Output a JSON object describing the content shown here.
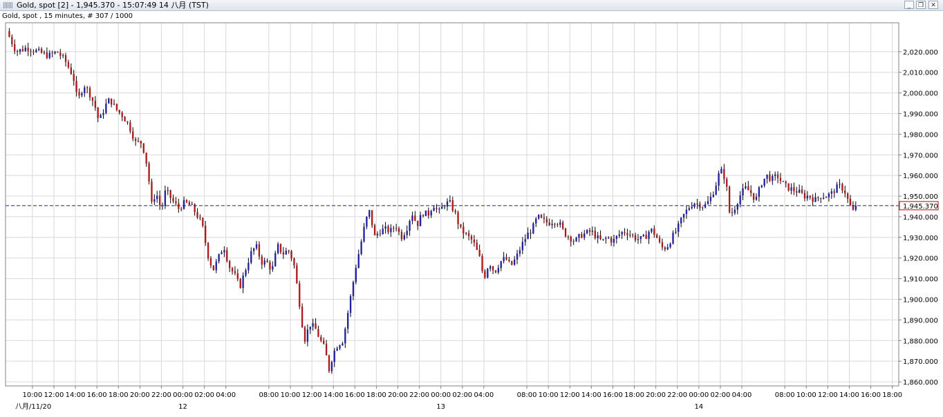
{
  "window": {
    "title": "Gold, spot [2] - 1,945.370 - 15:07:49  14 八月 (TST)",
    "icon": "chart-window-icon",
    "controls": {
      "minimize": "_",
      "maximize": "❐",
      "close": "✕"
    }
  },
  "chart_header": "Gold, spot , 15 minutes, # 307 / 1000",
  "colors": {
    "up_candle": "#2020a0",
    "down_candle": "#b01818",
    "grid": "#d8d8d8",
    "current_line": "#1c1c8c",
    "current_label": "#c00000"
  },
  "chart_data": {
    "type": "candlestick",
    "instrument": "Gold, spot",
    "interval": "15 minutes",
    "bars_shown": "307 / 1000",
    "current_price": 1945.37,
    "current_price_label": "1,945.370",
    "ylim": [
      1858,
      2034
    ],
    "y_ticks": [
      "2,020.000",
      "2,010.000",
      "2,000.000",
      "1,990.000",
      "1,980.000",
      "1,970.000",
      "1,960.000",
      "1,950.000",
      "1,940.000",
      "1,930.000",
      "1,920.000",
      "1,910.000",
      "1,900.000",
      "1,890.000",
      "1,880.000",
      "1,870.000",
      "1,860.000"
    ],
    "y_tick_values": [
      2020,
      2010,
      2000,
      1990,
      1980,
      1970,
      1960,
      1950,
      1940,
      1930,
      1920,
      1910,
      1900,
      1890,
      1880,
      1870,
      1860
    ],
    "x_range_hours": [
      7.5,
      90.6
    ],
    "x_ticks": [
      {
        "h": 10,
        "label": "10:00"
      },
      {
        "h": 12,
        "label": "12:00"
      },
      {
        "h": 14,
        "label": "14:00"
      },
      {
        "h": 16,
        "label": "16:00"
      },
      {
        "h": 18,
        "label": "18:00"
      },
      {
        "h": 20,
        "label": "20:00"
      },
      {
        "h": 22,
        "label": "22:00"
      },
      {
        "h": 24,
        "label": "00:00"
      },
      {
        "h": 26,
        "label": "02:00"
      },
      {
        "h": 28,
        "label": "04:00"
      },
      {
        "h": 32,
        "label": "08:00"
      },
      {
        "h": 34,
        "label": "10:00"
      },
      {
        "h": 36,
        "label": "12:00"
      },
      {
        "h": 38,
        "label": "14:00"
      },
      {
        "h": 40,
        "label": "16:00"
      },
      {
        "h": 42,
        "label": "18:00"
      },
      {
        "h": 44,
        "label": "20:00"
      },
      {
        "h": 46,
        "label": "22:00"
      },
      {
        "h": 48,
        "label": "00:00"
      },
      {
        "h": 50,
        "label": "02:00"
      },
      {
        "h": 52,
        "label": "04:00"
      },
      {
        "h": 56,
        "label": "08:00"
      },
      {
        "h": 58,
        "label": "10:00"
      },
      {
        "h": 60,
        "label": "12:00"
      },
      {
        "h": 62,
        "label": "14:00"
      },
      {
        "h": 64,
        "label": "16:00"
      },
      {
        "h": 66,
        "label": "18:00"
      },
      {
        "h": 68,
        "label": "20:00"
      },
      {
        "h": 70,
        "label": "22:00"
      },
      {
        "h": 72,
        "label": "00:00"
      },
      {
        "h": 74,
        "label": "02:00"
      },
      {
        "h": 76,
        "label": "04:00"
      },
      {
        "h": 80,
        "label": "08:00"
      },
      {
        "h": 82,
        "label": "10:00"
      },
      {
        "h": 84,
        "label": "12:00"
      },
      {
        "h": 86,
        "label": "14:00"
      },
      {
        "h": 88,
        "label": "16:00"
      },
      {
        "h": 90,
        "label": "18:00"
      }
    ],
    "date_labels": [
      {
        "h": 9,
        "label": "八月/11/20"
      },
      {
        "h": 24,
        "label": "12"
      },
      {
        "h": 48,
        "label": "13"
      },
      {
        "h": 72,
        "label": "14"
      }
    ],
    "price_path": [
      [
        7.6,
        2030
      ],
      [
        8.5,
        2020
      ],
      [
        9.5,
        2022
      ],
      [
        10.5,
        2020
      ],
      [
        11.5,
        2018
      ],
      [
        12.3,
        2020
      ],
      [
        13,
        2016
      ],
      [
        13.8,
        2008
      ],
      [
        14.2,
        1996
      ],
      [
        14.8,
        2004
      ],
      [
        15.3,
        2000
      ],
      [
        15.8,
        1994
      ],
      [
        16.2,
        1986
      ],
      [
        16.8,
        1994
      ],
      [
        17.2,
        1997
      ],
      [
        17.8,
        1992
      ],
      [
        18.4,
        1989
      ],
      [
        19,
        1984
      ],
      [
        19.6,
        1976
      ],
      [
        20.2,
        1976
      ],
      [
        20.7,
        1964
      ],
      [
        21.1,
        1946
      ],
      [
        21.5,
        1952
      ],
      [
        22,
        1943
      ],
      [
        22.4,
        1953
      ],
      [
        23,
        1948
      ],
      [
        23.6,
        1944
      ],
      [
        24.2,
        1947
      ],
      [
        24.8,
        1945
      ],
      [
        25.3,
        1941
      ],
      [
        25.8,
        1936
      ],
      [
        26.3,
        1922
      ],
      [
        26.8,
        1914
      ],
      [
        27.3,
        1920
      ],
      [
        27.8,
        1926
      ],
      [
        28.3,
        1916
      ],
      [
        28.8,
        1912
      ],
      [
        29.3,
        1906
      ],
      [
        29.8,
        1914
      ],
      [
        30.3,
        1922
      ],
      [
        30.8,
        1926
      ],
      [
        31.3,
        1918
      ],
      [
        31.8,
        1918
      ],
      [
        32.3,
        1914
      ],
      [
        32.8,
        1926
      ],
      [
        33.3,
        1922
      ],
      [
        33.8,
        1924
      ],
      [
        34.3,
        1918
      ],
      [
        34.8,
        1900
      ],
      [
        35.3,
        1880
      ],
      [
        35.8,
        1888
      ],
      [
        36.3,
        1886
      ],
      [
        36.8,
        1880
      ],
      [
        37.2,
        1876
      ],
      [
        37.6,
        1866
      ],
      [
        38,
        1874
      ],
      [
        38.4,
        1878
      ],
      [
        38.9,
        1880
      ],
      [
        39.3,
        1892
      ],
      [
        39.7,
        1904
      ],
      [
        40.1,
        1916
      ],
      [
        40.6,
        1928
      ],
      [
        41,
        1938
      ],
      [
        41.4,
        1943
      ],
      [
        41.8,
        1930
      ],
      [
        42.3,
        1933
      ],
      [
        42.8,
        1934
      ],
      [
        43.3,
        1933
      ],
      [
        43.8,
        1936
      ],
      [
        44.3,
        1930
      ],
      [
        44.8,
        1934
      ],
      [
        45.3,
        1942
      ],
      [
        45.8,
        1936
      ],
      [
        46.3,
        1942
      ],
      [
        46.8,
        1941
      ],
      [
        47.3,
        1946
      ],
      [
        47.8,
        1942
      ],
      [
        48.3,
        1946
      ],
      [
        48.8,
        1947
      ],
      [
        49.3,
        1942
      ],
      [
        49.8,
        1934
      ],
      [
        50.4,
        1931
      ],
      [
        51,
        1928
      ],
      [
        51.6,
        1920
      ],
      [
        52,
        1910
      ],
      [
        52.5,
        1918
      ],
      [
        53,
        1913
      ],
      [
        53.5,
        1918
      ],
      [
        54,
        1920
      ],
      [
        54.5,
        1916
      ],
      [
        55,
        1920
      ],
      [
        55.5,
        1926
      ],
      [
        56,
        1931
      ],
      [
        56.5,
        1934
      ],
      [
        57,
        1940
      ],
      [
        57.5,
        1938
      ],
      [
        58,
        1937
      ],
      [
        58.5,
        1938
      ],
      [
        59,
        1937
      ],
      [
        59.5,
        1932
      ],
      [
        60,
        1930
      ],
      [
        60.5,
        1928
      ],
      [
        61,
        1931
      ],
      [
        61.5,
        1932
      ],
      [
        62,
        1933
      ],
      [
        62.5,
        1930
      ],
      [
        63,
        1928
      ],
      [
        63.5,
        1930
      ],
      [
        64,
        1928
      ],
      [
        64.5,
        1931
      ],
      [
        65,
        1933
      ],
      [
        65.5,
        1932
      ],
      [
        66,
        1930
      ],
      [
        66.5,
        1929
      ],
      [
        67,
        1930
      ],
      [
        67.5,
        1934
      ],
      [
        68,
        1931
      ],
      [
        68.5,
        1925
      ],
      [
        69,
        1925
      ],
      [
        69.5,
        1930
      ],
      [
        70,
        1934
      ],
      [
        70.5,
        1940
      ],
      [
        71,
        1944
      ],
      [
        71.5,
        1947
      ],
      [
        72,
        1946
      ],
      [
        72.5,
        1945
      ],
      [
        73,
        1948
      ],
      [
        73.5,
        1954
      ],
      [
        74,
        1963
      ],
      [
        74.5,
        1958
      ],
      [
        74.9,
        1940
      ],
      [
        75.3,
        1944
      ],
      [
        75.8,
        1950
      ],
      [
        76.3,
        1954
      ],
      [
        76.8,
        1952
      ],
      [
        77.3,
        1948
      ],
      [
        77.8,
        1956
      ],
      [
        78.3,
        1960
      ],
      [
        78.8,
        1958
      ],
      [
        79.3,
        1960
      ],
      [
        79.8,
        1956
      ],
      [
        80.3,
        1954
      ],
      [
        80.8,
        1953
      ],
      [
        81.3,
        1952
      ],
      [
        81.8,
        1950
      ],
      [
        82.3,
        1950
      ],
      [
        82.8,
        1948
      ],
      [
        83.3,
        1950
      ],
      [
        83.8,
        1950
      ],
      [
        84.3,
        1951
      ],
      [
        84.8,
        1954
      ],
      [
        85.2,
        1955
      ],
      [
        85.6,
        1952
      ],
      [
        86,
        1946
      ],
      [
        86.4,
        1942
      ],
      [
        86.8,
        1945.37
      ]
    ]
  }
}
